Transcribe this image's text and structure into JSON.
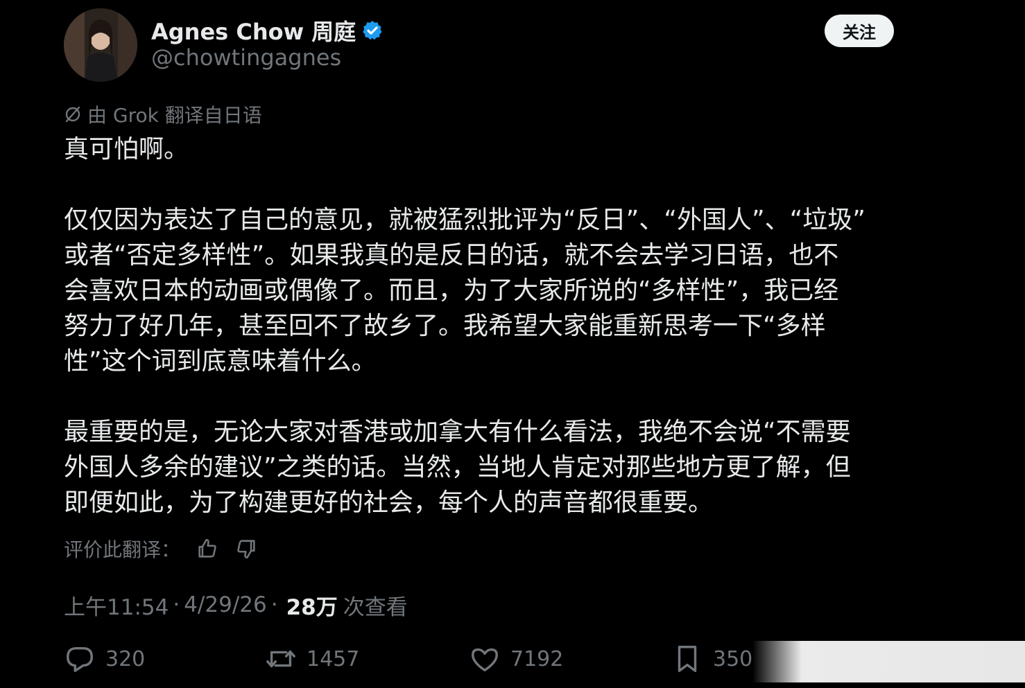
{
  "user": {
    "display_name": "Agnes Chow 周庭",
    "handle": "@chowtingagnes",
    "verified": true
  },
  "follow_button": {
    "label": "关注"
  },
  "translation": {
    "note": "由 Grok 翻译自日语"
  },
  "tweet": {
    "paragraphs": [
      "真可怕啊。",
      "仅仅因为表达了自己的意见，就被猛烈批评为“反日”、“外国人”、“垃圾”\n或者“否定多样性”。如果我真的是反日的话，就不会去学习日语，也不\n会喜欢日本的动画或偶像了。而且，为了大家所说的“多样性”，我已经\n努力了好几年，甚至回不了故乡了。我希望大家能重新思考一下“多样\n性”这个词到底意味着什么。",
      "最重要的是，无论大家对香港或加拿大有什么看法，我绝不会说“不需要\n外国人多余的建议”之类的话。当然，当地人肯定对那些地方更了解，但\n即便如此，为了构建更好的社会，每个人的声音都很重要。"
    ]
  },
  "rating": {
    "label": "评价此翻译：",
    "thumbs_up_icon": "thumbs-up-icon",
    "thumbs_down_icon": "thumbs-down-icon"
  },
  "meta": {
    "time": "上午11:54",
    "separator": "·",
    "date": "4/29/26",
    "views_count": "28万",
    "views_label": "次查看"
  },
  "actions": {
    "replies": "320",
    "retweets": "1457",
    "likes": "7192",
    "bookmarks": "350"
  },
  "colors": {
    "background": "#000000",
    "primary_text": "#e7e9ea",
    "secondary_text": "#71767b",
    "verified_blue": "#1d9bf0",
    "button_bg": "#eff3f4"
  }
}
